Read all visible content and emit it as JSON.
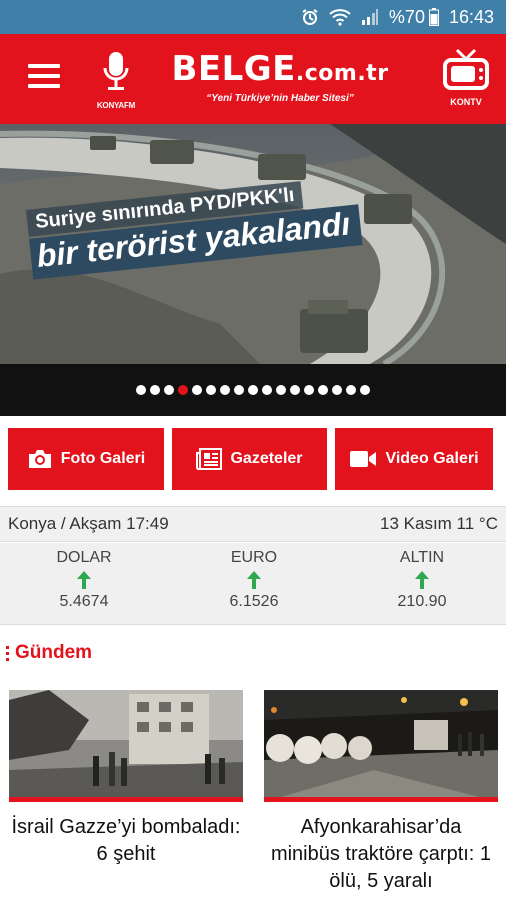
{
  "status_bar": {
    "battery": "%70",
    "time": "16:43",
    "icons": [
      "alarm-icon",
      "wifi-icon",
      "signal-icon",
      "battery-icon"
    ]
  },
  "header": {
    "radio_label": "KONYAFM",
    "brand_name": "BELGE",
    "brand_domain": ".com.tr",
    "slogan": "“Yeni Türkiye’nin Haber Sitesi”",
    "tv_label": "KONTV"
  },
  "hero": {
    "headline_line1": "Suriye sınırında PYD/PKK'lı",
    "headline_line2": "bir terörist yakalandı",
    "dot_count": 17,
    "active_dot": 3
  },
  "quick_links": {
    "photo_gallery": "Foto Galeri",
    "newspapers": "Gazeteler",
    "video_gallery": "Video Galeri"
  },
  "info": {
    "city_prayer": "Konya / Akşam 17:49",
    "date_temp": "13 Kasım 11 °C"
  },
  "currency": [
    {
      "name": "DOLAR",
      "value": "5.4674",
      "trend": "up"
    },
    {
      "name": "EURO",
      "value": "6.1526",
      "trend": "up"
    },
    {
      "name": "ALTIN",
      "value": "210.90",
      "trend": "up"
    }
  ],
  "section": {
    "title": "Gündem"
  },
  "news": [
    {
      "title": "İsrail Gazze’yi bombaladı: 6 şehit"
    },
    {
      "title": "Afyonkarahisar’da minibüs traktöre çarptı: 1 ölü, 5 yaralı"
    }
  ],
  "colors": {
    "brand_red": "#e3131d",
    "status_bar": "#3f7fa8",
    "up_green": "#2fa84f"
  }
}
